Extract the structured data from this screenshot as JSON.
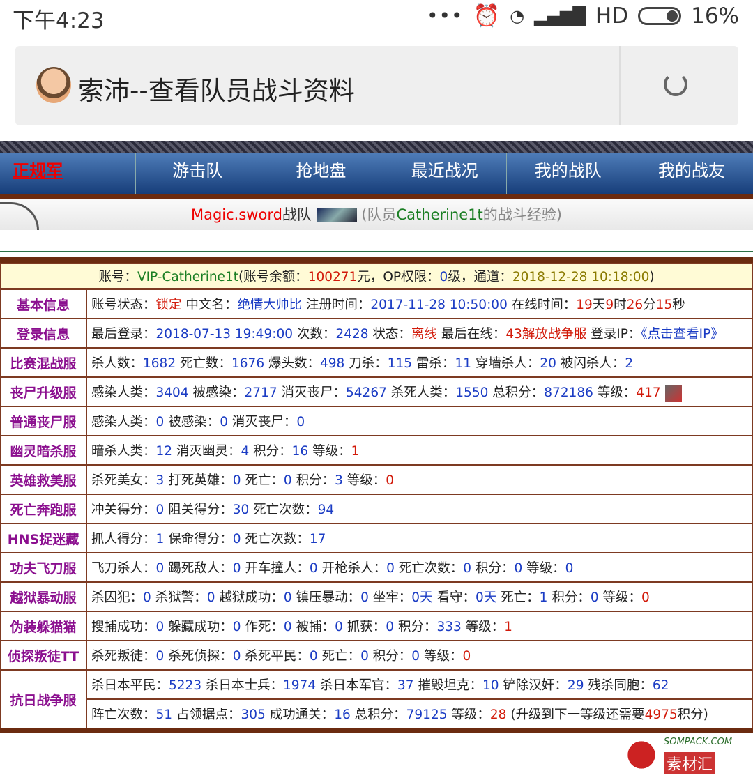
{
  "status_bar": {
    "time": "下午4:23",
    "dots": "•••",
    "network": "HD",
    "battery": "16%"
  },
  "browser": {
    "page_title": "索沛--查看队员战斗资料"
  },
  "nav": {
    "items": [
      "正规军",
      "游击队",
      "抢地盘",
      "最近战况",
      "我的战队",
      "我的战友"
    ]
  },
  "team": {
    "team_name": "Magic.sword",
    "team_suffix": "战队",
    "member_prefix": "(队员",
    "member": "Catherine1t",
    "member_suffix": "的战斗经验)"
  },
  "account": {
    "label": "账号：",
    "id": "VIP-Catherine1t",
    "balance_label": "(账号余额：",
    "balance": "100271",
    "yuan": "元，",
    "op_label": "OP权限：",
    "op": "0",
    "op_unit": "级，",
    "channel_label": "通道：",
    "channel": "2018-12-28 10:18:00",
    "close": ")"
  },
  "rows": {
    "basic": {
      "label": "基本信息",
      "status_label": "账号状态：",
      "status": "锁定",
      "cn_label": "中文名：",
      "cn": "绝情大帅比",
      "reg_label": "注册时间：",
      "reg": "2017-11-28 10:50:00",
      "online_label": "在线时间：",
      "d": "19",
      "d_u": "天",
      "h": "9",
      "h_u": "时",
      "m": "26",
      "m_u": "分",
      "s": "15",
      "s_u": "秒"
    },
    "login": {
      "label": "登录信息",
      "last_label": "最后登录：",
      "last": "2018-07-13 19:49:00",
      "count_label": "次数：",
      "count": "2428",
      "state_label": "状态：",
      "state": "离线",
      "online_label": "最后在线：",
      "online": "43解放战争服",
      "ip_label": "登录IP：",
      "ip": "《点击查看IP》"
    },
    "mix": {
      "label": "比赛混战服",
      "a_l": "杀人数：",
      "a": "1682",
      "b_l": "死亡数：",
      "b": "1676",
      "c_l": "爆头数：",
      "c": "498",
      "d_l": "刀杀：",
      "d": "115",
      "e_l": "雷杀：",
      "e": "11",
      "f_l": "穿墙杀人：",
      "f": "20",
      "g_l": "被闪杀人：",
      "g": "2"
    },
    "zombie_up": {
      "label": "丧尸升级服",
      "a_l": "感染人类：",
      "a": "3404",
      "b_l": "被感染：",
      "b": "2717",
      "c_l": "消灭丧尸：",
      "c": "54267",
      "d_l": "杀死人类：",
      "d": "1550",
      "e_l": "总积分：",
      "e": "872186",
      "f_l": "等级：",
      "f": "417"
    },
    "zombie": {
      "label": "普通丧尸服",
      "a_l": "感染人类：",
      "a": "0",
      "b_l": "被感染：",
      "b": "0",
      "c_l": "消灭丧尸：",
      "c": "0"
    },
    "ghost": {
      "label": "幽灵暗杀服",
      "a_l": "暗杀人类：",
      "a": "12",
      "b_l": "消灭幽灵：",
      "b": "4",
      "c_l": "积分：",
      "c": "16",
      "d_l": "等级：",
      "d": "1"
    },
    "hero": {
      "label": "英雄救美服",
      "a_l": "杀死美女：",
      "a": "3",
      "b_l": "打死英雄：",
      "b": "0",
      "c_l": "死亡：",
      "c": "0",
      "d_l": "积分：",
      "d": "3",
      "e_l": "等级：",
      "e": "0"
    },
    "run": {
      "label": "死亡奔跑服",
      "a_l": "冲关得分：",
      "a": "0",
      "b_l": "阻关得分：",
      "b": "30",
      "c_l": "死亡次数：",
      "c": "94"
    },
    "hns": {
      "label": "HNS捉迷藏",
      "a_l": "抓人得分：",
      "a": "1",
      "b_l": "保命得分：",
      "b": "0",
      "c_l": "死亡次数：",
      "c": "17"
    },
    "kungfu": {
      "label": "功夫飞刀服",
      "a_l": "飞刀杀人：",
      "a": "0",
      "b_l": "踢死敌人：",
      "b": "0",
      "c_l": "开车撞人：",
      "c": "0",
      "d_l": "开枪杀人：",
      "d": "0",
      "e_l": "死亡次数：",
      "e": "0",
      "f_l": "积分：",
      "f": "0",
      "g_l": "等级：",
      "g": "0"
    },
    "jail": {
      "label": "越狱暴动服",
      "a_l": "杀囚犯：",
      "a": "0",
      "b_l": "杀狱警：",
      "b": "0",
      "c_l": "越狱成功：",
      "c": "0",
      "d_l": "镇压暴动：",
      "d": "0",
      "e_l": "坐牢：",
      "e": "0天",
      "f_l": "看守：",
      "f": "0天",
      "g_l": "死亡：",
      "g": "1",
      "h_l": "积分：",
      "h": "0",
      "i_l": "等级：",
      "i": "0"
    },
    "hide": {
      "label": "伪装躲猫猫",
      "a_l": "搜捕成功：",
      "a": "0",
      "b_l": "躲藏成功：",
      "b": "0",
      "c_l": "作死：",
      "c": "0",
      "d_l": "被捕：",
      "d": "0",
      "e_l": "抓获：",
      "e": "0",
      "f_l": "积分：",
      "f": "333",
      "g_l": "等级：",
      "g": "1"
    },
    "tt": {
      "label": "侦探叛徒TT",
      "a_l": "杀死叛徒：",
      "a": "0",
      "b_l": "杀死侦探：",
      "b": "0",
      "c_l": "杀死平民：",
      "c": "0",
      "d_l": "死亡：",
      "d": "0",
      "e_l": "积分：",
      "e": "0",
      "f_l": "等级：",
      "f": "0"
    },
    "war": {
      "label": "抗日战争服",
      "a_l": "杀日本平民：",
      "a": "5223",
      "b_l": "杀日本士兵：",
      "b": "1974",
      "c_l": "杀日本军官：",
      "c": "37",
      "d_l": "摧毁坦克：",
      "d": "10",
      "e_l": "铲除汉奸：",
      "e": "29",
      "f_l": "残杀同胞：",
      "f": "62",
      "g_l": "阵亡次数：",
      "g": "51",
      "h_l": "占领据点：",
      "h": "305",
      "i_l": "成功通关：",
      "i": "16",
      "j_l": "总积分：",
      "j": "79125",
      "k_l": "等级：",
      "k": "28",
      "up_l": "(升级到下一等级还需要",
      "up": "4975",
      "up_u": "积分)"
    }
  },
  "watermark": {
    "url": "SOMPACK.COM",
    "name": "素材汇"
  }
}
